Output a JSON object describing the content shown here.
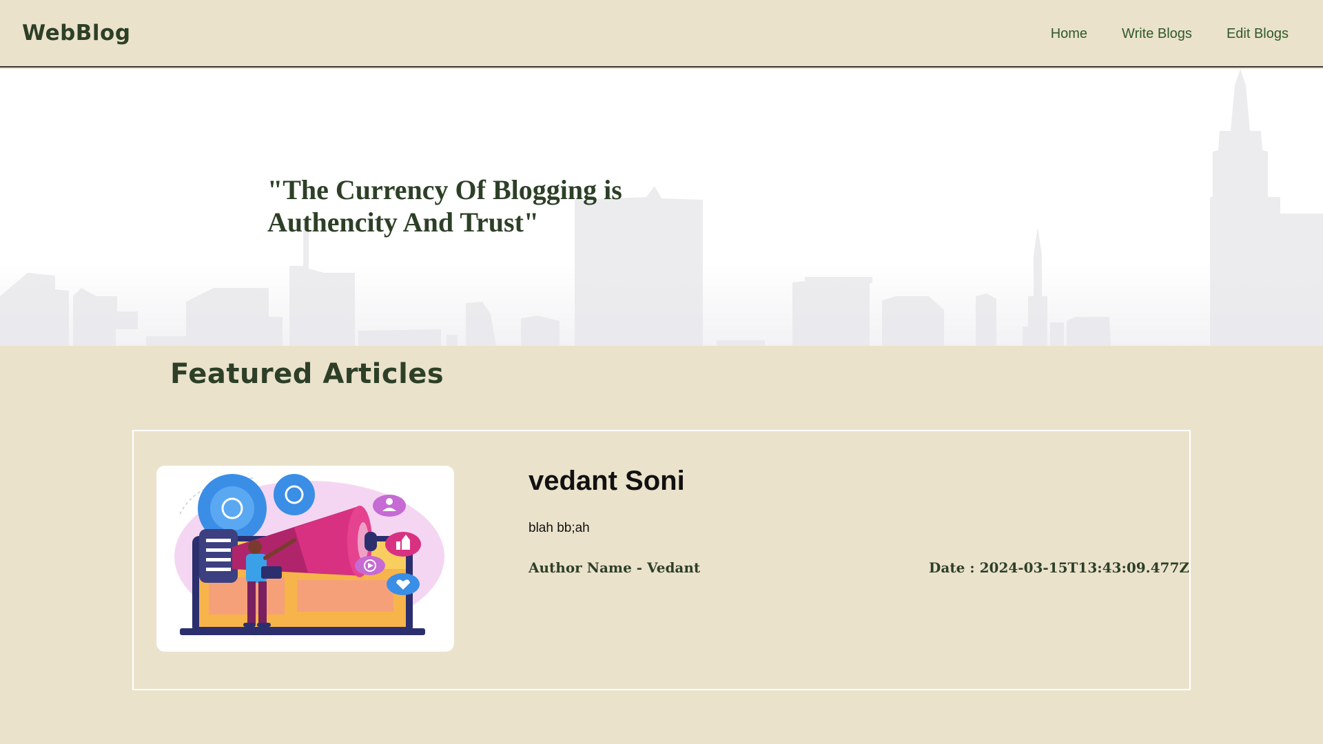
{
  "navbar": {
    "brand": "WebBlog",
    "links": [
      "Home",
      "Write Blogs",
      "Edit Blogs"
    ]
  },
  "hero": {
    "quote_line1": "\"The Currency Of Blogging is",
    "quote_line2": "Authencity And Trust\""
  },
  "featured": {
    "title": "Featured Articles",
    "articles": [
      {
        "title": "vedant Soni",
        "body": "blah bb;ah",
        "author": "Author Name - Vedant",
        "date": "Date : 2024-03-15T13:43:09.477Z",
        "image_icon": "megaphone-marketing-illustration"
      }
    ]
  },
  "colors": {
    "background": "#ebe2cc",
    "brand_green": "#2d4027",
    "link_green": "#2e5a2a",
    "skyline": "#ececef"
  }
}
